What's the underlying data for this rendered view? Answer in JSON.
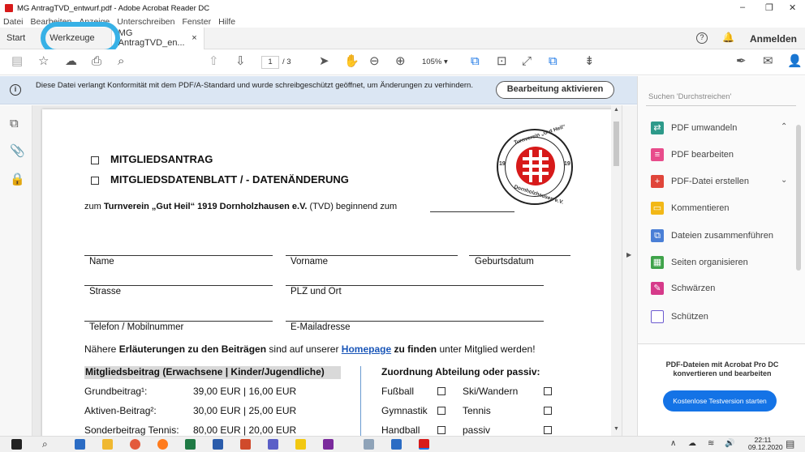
{
  "window": {
    "title": "MG AntragTVD_entwurf.pdf - Adobe Acrobat Reader DC",
    "minimize": "–",
    "maximize": "❐",
    "close": "✕"
  },
  "menu": [
    "Datei",
    "Bearbeiten",
    "Anzeige",
    "Unterschreiben",
    "Fenster",
    "Hilfe"
  ],
  "tabs": {
    "start": "Start",
    "tools": "Werkzeuge",
    "doc": "MG AntragTVD_en...",
    "doc_close": "×",
    "help": "?",
    "login": "Anmelden"
  },
  "toolbar": {
    "page_current": "1",
    "page_total": "/ 3",
    "zoom": "105%"
  },
  "infobar": {
    "message": "Diese Datei verlangt Konformität mit dem PDF/A-Standard und wurde schreibgeschützt geöffnet, um Änderungen zu verhindern.",
    "button": "Bearbeitung aktivieren"
  },
  "rightpanel": {
    "search_placeholder": "Suchen 'Durchstreichen'",
    "items": [
      "PDF umwandeln",
      "PDF bearbeiten",
      "PDF-Datei erstellen",
      "Kommentieren",
      "Dateien zusammenführen",
      "Seiten organisieren",
      "Schwärzen",
      "Schützen"
    ],
    "promo_text": "PDF-Dateien mit Acrobat Pro DC konvertieren und bearbeiten",
    "promo_button": "Kostenlose Testversion starten"
  },
  "pdf": {
    "title1": "MITGLIEDSANTRAG",
    "title2": "MITGLIEDSDATENBLATT / - DATENÄNDERUNG",
    "intro_a": "zum ",
    "intro_b": "Turnverein „Gut Heil“ 1919 Dornholzhausen e.V.",
    "intro_c": " (TVD) beginnend zum",
    "logo_top": "Turnverein „Gut Heil“",
    "logo_bottom": "Dornholzhausen e.V.",
    "logo_left": "19",
    "logo_right": "19",
    "f_name": "Name",
    "f_vorname": "Vorname",
    "f_geb": "Geburtsdatum",
    "f_strasse": "Strasse",
    "f_plz": "PLZ und Ort",
    "f_tel": "Telefon / Mobilnummer",
    "f_mail": "E-Mailadresse",
    "note_a": "Nähere ",
    "note_b": "Erläuterungen zu den Beiträgen",
    "note_c": " sind auf unserer ",
    "note_link": "Homepage",
    "note_d": " zu finden",
    "note_e": " unter Mitglied werden!",
    "fee_header": "Mitgliedsbeitrag (Erwachsene | Kinder/Jugendliche)",
    "dept_header": "Zuordnung Abteilung oder passiv:",
    "fees": [
      {
        "label": "Grundbeitrag¹:",
        "value": "39,00 EUR | 16,00 EUR"
      },
      {
        "label": "Aktiven-Beitrag²:",
        "value": "30,00 EUR | 25,00 EUR"
      },
      {
        "label": "Sonderbeitrag Tennis:",
        "value": "80,00 EUR | 20,00 EUR"
      }
    ],
    "depts": [
      {
        "a": "Fußball",
        "b": "Ski/Wandern"
      },
      {
        "a": "Gymnastik",
        "b": "Tennis"
      },
      {
        "a": "Handball",
        "b": "passiv"
      }
    ]
  },
  "clock": {
    "time": "22:11",
    "date": "09.12.2020"
  },
  "colors": {
    "accent": "#1473e6",
    "info": "#dbe6f3",
    "highlight": "#37b1e6",
    "acrobat_red": "#d71a1a"
  }
}
